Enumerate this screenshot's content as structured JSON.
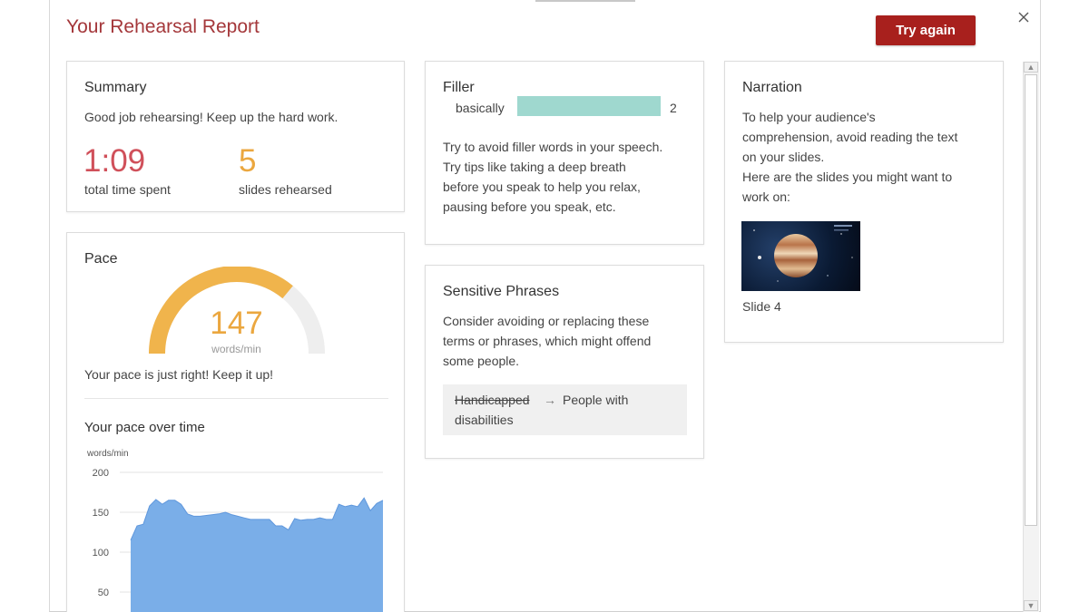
{
  "header": {
    "title": "Your Rehearsal Report",
    "try_again_label": "Try again",
    "close_icon": "close-icon"
  },
  "summary": {
    "title": "Summary",
    "message": "Good job rehearsing! Keep up the hard work.",
    "time_value": "1:09",
    "time_label": "total time spent",
    "slides_value": "5",
    "slides_label": "slides rehearsed"
  },
  "pace": {
    "title": "Pace",
    "value": "147",
    "unit": "words/min",
    "gauge_fraction": 0.72,
    "message": "Your pace is just right! Keep it up!",
    "over_time_title": "Your pace over time",
    "chart_unit": "words/min"
  },
  "filler": {
    "title": "Filler",
    "word": "basically",
    "count": "2",
    "tip": [
      "Try to avoid filler words in your speech.",
      "Try tips like taking a deep breath",
      "before you speak to help you relax,",
      "pausing before you speak, etc."
    ]
  },
  "sensitive": {
    "title": "Sensitive Phrases",
    "description": [
      "Consider avoiding or replacing these",
      "terms or phrases, which might offend",
      "some people."
    ],
    "original": "Handicapped",
    "arrow": "→",
    "replacement_line1": "People with",
    "replacement_line2": "disabilities"
  },
  "narration": {
    "title": "Narration",
    "description": [
      "To help your audience's",
      "comprehension, avoid reading the text",
      "on your slides.",
      "Here are the slides you might want to",
      "work on:"
    ],
    "slide_label": "Slide 4"
  },
  "colors": {
    "accent": "#a4373a",
    "button": "#a8201d",
    "time": "#d0505a",
    "slides": "#eba73f",
    "gauge": "#f0b44c",
    "filler_bar": "#9fd8cf",
    "chart_fill": "#7aaee8"
  },
  "chart_data": {
    "type": "area",
    "ylabel": "words/min",
    "ylim": [
      0,
      200
    ],
    "yticks": [
      200,
      150,
      100,
      50
    ],
    "x": [
      0,
      1,
      2,
      3,
      4,
      5,
      6,
      7,
      8,
      9,
      10,
      11,
      12,
      13,
      14,
      15,
      16,
      17,
      18,
      19,
      20,
      21,
      22,
      23,
      24,
      25,
      26,
      27,
      28,
      29,
      30,
      31,
      32,
      33,
      34,
      35,
      36,
      37,
      38,
      39,
      40
    ],
    "values": [
      115,
      133,
      135,
      158,
      166,
      160,
      165,
      165,
      160,
      148,
      145,
      145,
      146,
      147,
      148,
      150,
      147,
      145,
      143,
      141,
      141,
      141,
      141,
      133,
      133,
      128,
      142,
      140,
      141,
      141,
      143,
      141,
      141,
      160,
      157,
      159,
      157,
      168,
      152,
      161,
      165
    ]
  }
}
